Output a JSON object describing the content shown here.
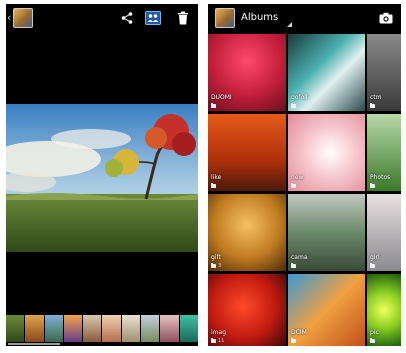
{
  "viewer": {
    "icons": {
      "app": "gallery-app-icon",
      "back": "back-chevron-icon",
      "share": "share-icon",
      "people": "people-icon",
      "delete": "trash-icon"
    },
    "filmstrip_count": 10
  },
  "albums_screen": {
    "title": "Albums",
    "icons": {
      "app": "gallery-app-icon",
      "camera": "camera-icon",
      "folder": "folder-icon"
    },
    "albums": [
      {
        "name": "DUOMI",
        "count": ""
      },
      {
        "name": "gofoll",
        "count": ""
      },
      {
        "name": "ctm",
        "count": ""
      },
      {
        "name": "like",
        "count": ""
      },
      {
        "name": "new",
        "count": ""
      },
      {
        "name": "Photos",
        "count": ""
      },
      {
        "name": "gift",
        "count": "3"
      },
      {
        "name": "cama",
        "count": ""
      },
      {
        "name": "girl",
        "count": ""
      },
      {
        "name": "imag",
        "count": "11"
      },
      {
        "name": "DCIM",
        "count": ""
      },
      {
        "name": "pic",
        "count": ""
      }
    ]
  },
  "colors": {
    "background": "#000000",
    "bar": "#0b0b0b"
  }
}
